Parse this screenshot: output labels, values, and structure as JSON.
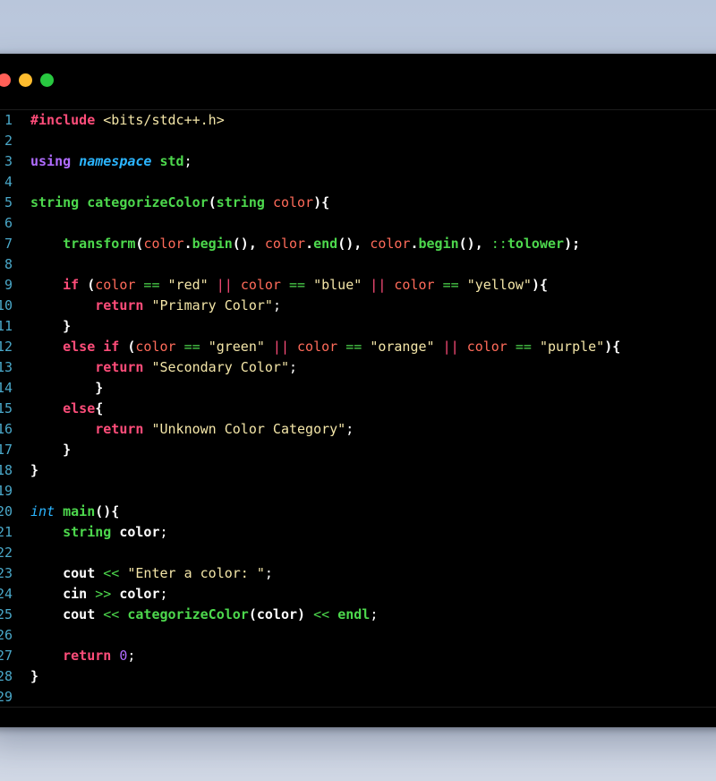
{
  "window": {
    "controls": [
      "close",
      "minimize",
      "maximize"
    ]
  },
  "lines": [
    {
      "n": "1",
      "tokens": [
        {
          "t": "#include",
          "c": "pre"
        },
        {
          "t": " ",
          "c": "plainn"
        },
        {
          "t": "<bits/stdc++.h>",
          "c": "inc"
        }
      ]
    },
    {
      "n": "2",
      "tokens": []
    },
    {
      "n": "3",
      "tokens": [
        {
          "t": "using",
          "c": "kw-using"
        },
        {
          "t": " ",
          "c": "plainn"
        },
        {
          "t": "namespace",
          "c": "kw-ns"
        },
        {
          "t": " ",
          "c": "plainn"
        },
        {
          "t": "std",
          "c": "kw-type"
        },
        {
          "t": ";",
          "c": "plainn"
        }
      ]
    },
    {
      "n": "4",
      "tokens": []
    },
    {
      "n": "5",
      "tokens": [
        {
          "t": "string",
          "c": "kw-type"
        },
        {
          "t": " ",
          "c": "plainn"
        },
        {
          "t": "categorizeColor",
          "c": "fn"
        },
        {
          "t": "(",
          "c": "plain"
        },
        {
          "t": "string",
          "c": "kw-type"
        },
        {
          "t": " ",
          "c": "plainn"
        },
        {
          "t": "color",
          "c": "var"
        },
        {
          "t": "){",
          "c": "plain"
        }
      ]
    },
    {
      "n": "6",
      "tokens": []
    },
    {
      "n": "7",
      "tokens": [
        {
          "t": "    ",
          "c": "plainn"
        },
        {
          "t": "transform",
          "c": "fn"
        },
        {
          "t": "(",
          "c": "plain"
        },
        {
          "t": "color",
          "c": "var"
        },
        {
          "t": ".",
          "c": "plain"
        },
        {
          "t": "begin",
          "c": "fn"
        },
        {
          "t": "(), ",
          "c": "plain"
        },
        {
          "t": "color",
          "c": "var"
        },
        {
          "t": ".",
          "c": "plain"
        },
        {
          "t": "end",
          "c": "fn"
        },
        {
          "t": "(), ",
          "c": "plain"
        },
        {
          "t": "color",
          "c": "var"
        },
        {
          "t": ".",
          "c": "plain"
        },
        {
          "t": "begin",
          "c": "fn"
        },
        {
          "t": "(), ",
          "c": "plain"
        },
        {
          "t": "::",
          "c": "op2"
        },
        {
          "t": "tolower",
          "c": "fn"
        },
        {
          "t": ");",
          "c": "plain"
        }
      ]
    },
    {
      "n": "8",
      "tokens": []
    },
    {
      "n": "9",
      "tokens": [
        {
          "t": "    ",
          "c": "plainn"
        },
        {
          "t": "if",
          "c": "kw-ctrl"
        },
        {
          "t": " (",
          "c": "plain"
        },
        {
          "t": "color",
          "c": "var"
        },
        {
          "t": " == ",
          "c": "op2"
        },
        {
          "t": "\"red\"",
          "c": "str"
        },
        {
          "t": " || ",
          "c": "op"
        },
        {
          "t": "color",
          "c": "var"
        },
        {
          "t": " == ",
          "c": "op2"
        },
        {
          "t": "\"blue\"",
          "c": "str"
        },
        {
          "t": " || ",
          "c": "op"
        },
        {
          "t": "color",
          "c": "var"
        },
        {
          "t": " == ",
          "c": "op2"
        },
        {
          "t": "\"yellow\"",
          "c": "str"
        },
        {
          "t": "){",
          "c": "plain"
        }
      ]
    },
    {
      "n": "10",
      "tokens": [
        {
          "t": "        ",
          "c": "plainn"
        },
        {
          "t": "return",
          "c": "kw-ctrl"
        },
        {
          "t": " ",
          "c": "plainn"
        },
        {
          "t": "\"Primary Color\"",
          "c": "str"
        },
        {
          "t": ";",
          "c": "plainn"
        }
      ]
    },
    {
      "n": "11",
      "tokens": [
        {
          "t": "    ",
          "c": "plainn"
        },
        {
          "t": "}",
          "c": "plain"
        }
      ]
    },
    {
      "n": "12",
      "tokens": [
        {
          "t": "    ",
          "c": "plainn"
        },
        {
          "t": "else",
          "c": "kw-ctrl"
        },
        {
          "t": " ",
          "c": "plainn"
        },
        {
          "t": "if",
          "c": "kw-ctrl"
        },
        {
          "t": " (",
          "c": "plain"
        },
        {
          "t": "color",
          "c": "var"
        },
        {
          "t": " == ",
          "c": "op2"
        },
        {
          "t": "\"green\"",
          "c": "str"
        },
        {
          "t": " || ",
          "c": "op"
        },
        {
          "t": "color",
          "c": "var"
        },
        {
          "t": " == ",
          "c": "op2"
        },
        {
          "t": "\"orange\"",
          "c": "str"
        },
        {
          "t": " || ",
          "c": "op"
        },
        {
          "t": "color",
          "c": "var"
        },
        {
          "t": " == ",
          "c": "op2"
        },
        {
          "t": "\"purple\"",
          "c": "str"
        },
        {
          "t": "){",
          "c": "plain"
        }
      ]
    },
    {
      "n": "13",
      "tokens": [
        {
          "t": "        ",
          "c": "plainn"
        },
        {
          "t": "return",
          "c": "kw-ctrl"
        },
        {
          "t": " ",
          "c": "plainn"
        },
        {
          "t": "\"Secondary Color\"",
          "c": "str"
        },
        {
          "t": ";",
          "c": "plainn"
        }
      ]
    },
    {
      "n": "14",
      "tokens": [
        {
          "t": "        ",
          "c": "plainn"
        },
        {
          "t": "}",
          "c": "plain"
        }
      ]
    },
    {
      "n": "15",
      "tokens": [
        {
          "t": "    ",
          "c": "plainn"
        },
        {
          "t": "else",
          "c": "kw-ctrl"
        },
        {
          "t": "{",
          "c": "plain"
        }
      ]
    },
    {
      "n": "16",
      "tokens": [
        {
          "t": "        ",
          "c": "plainn"
        },
        {
          "t": "return",
          "c": "kw-ctrl"
        },
        {
          "t": " ",
          "c": "plainn"
        },
        {
          "t": "\"Unknown Color Category\"",
          "c": "str"
        },
        {
          "t": ";",
          "c": "plainn"
        }
      ]
    },
    {
      "n": "17",
      "tokens": [
        {
          "t": "    ",
          "c": "plainn"
        },
        {
          "t": "}",
          "c": "plain"
        }
      ]
    },
    {
      "n": "18",
      "tokens": [
        {
          "t": "}",
          "c": "plain"
        }
      ]
    },
    {
      "n": "19",
      "tokens": []
    },
    {
      "n": "20",
      "tokens": [
        {
          "t": "int",
          "c": "kw-int"
        },
        {
          "t": " ",
          "c": "plainn"
        },
        {
          "t": "main",
          "c": "fn"
        },
        {
          "t": "(){",
          "c": "plain"
        }
      ]
    },
    {
      "n": "21",
      "tokens": [
        {
          "t": "    ",
          "c": "plainn"
        },
        {
          "t": "string",
          "c": "kw-type"
        },
        {
          "t": " ",
          "c": "plainn"
        },
        {
          "t": "color",
          "c": "plain"
        },
        {
          "t": ";",
          "c": "plainn"
        }
      ]
    },
    {
      "n": "22",
      "tokens": []
    },
    {
      "n": "23",
      "tokens": [
        {
          "t": "    ",
          "c": "plainn"
        },
        {
          "t": "cout",
          "c": "plain"
        },
        {
          "t": " << ",
          "c": "op2"
        },
        {
          "t": "\"Enter a color: \"",
          "c": "str"
        },
        {
          "t": ";",
          "c": "plainn"
        }
      ]
    },
    {
      "n": "24",
      "tokens": [
        {
          "t": "    ",
          "c": "plainn"
        },
        {
          "t": "cin",
          "c": "plain"
        },
        {
          "t": " >> ",
          "c": "op2"
        },
        {
          "t": "color",
          "c": "plain"
        },
        {
          "t": ";",
          "c": "plainn"
        }
      ]
    },
    {
      "n": "25",
      "tokens": [
        {
          "t": "    ",
          "c": "plainn"
        },
        {
          "t": "cout",
          "c": "plain"
        },
        {
          "t": " << ",
          "c": "op2"
        },
        {
          "t": "categorizeColor",
          "c": "fn"
        },
        {
          "t": "(color)",
          "c": "plain"
        },
        {
          "t": " << ",
          "c": "op2"
        },
        {
          "t": "endl",
          "c": "fn"
        },
        {
          "t": ";",
          "c": "plainn"
        }
      ]
    },
    {
      "n": "26",
      "tokens": []
    },
    {
      "n": "27",
      "tokens": [
        {
          "t": "    ",
          "c": "plainn"
        },
        {
          "t": "return",
          "c": "kw-ctrl"
        },
        {
          "t": " ",
          "c": "plainn"
        },
        {
          "t": "0",
          "c": "num"
        },
        {
          "t": ";",
          "c": "plainn"
        }
      ]
    },
    {
      "n": "28",
      "tokens": [
        {
          "t": "}",
          "c": "plain"
        }
      ]
    },
    {
      "n": "29",
      "tokens": []
    }
  ],
  "colors": {
    "background": "#000000",
    "line_number": "#4aa8c9",
    "keyword_control": "#ff4d7a",
    "keyword_using": "#b06cff",
    "type": "#4dd84d",
    "string": "#f4e6a8",
    "variable": "#ff6b5a"
  }
}
